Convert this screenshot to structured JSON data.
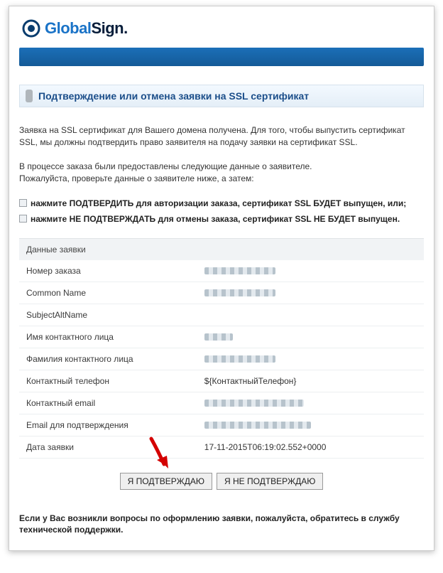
{
  "brand": {
    "global": "Global",
    "sign": "Sign",
    "dot": "."
  },
  "title": "Подтверждение или отмена заявки на SSL сертификат",
  "intro": "Заявка на SSL сертификат для Вашего домена получена. Для того, чтобы выпустить сертификат SSL, мы должны подтвердить право заявителя на подачу заявки на сертификат SSL.",
  "process1": "В процессе заказа были предоставлены следующие данные о заявителе.",
  "process2": "Пожалуйста, проверьте данные о заявителе ниже, а затем:",
  "bullets": [
    "нажмите ПОДТВЕРДИТЬ для авторизации заказа, сертификат SSL БУДЕТ выпущен, или;",
    "нажмите НЕ ПОДТВЕРЖДАТЬ для отмены заказа, сертификат SSL НЕ БУДЕТ выпущен."
  ],
  "section_header": "Данные заявки",
  "rows": {
    "order_no": {
      "label": "Номер заказа",
      "value": ""
    },
    "common_name": {
      "label": "Common Name",
      "value": ""
    },
    "san": {
      "label": "SubjectAltName",
      "value": ""
    },
    "first_name": {
      "label": "Имя контактного лица",
      "value": ""
    },
    "last_name": {
      "label": "Фамилия контактного лица",
      "value": ""
    },
    "phone": {
      "label": "Контактный телефон",
      "value": "${КонтактныйТелефон}"
    },
    "email": {
      "label": "Контактный email",
      "value": ""
    },
    "approve_email": {
      "label": "Email для подтверждения",
      "value": ""
    },
    "date": {
      "label": "Дата заявки",
      "value": "17-11-2015T06:19:02.552+0000"
    }
  },
  "buttons": {
    "approve": "Я ПОДТВЕРЖДАЮ",
    "decline": "Я НЕ ПОДТВЕРЖДАЮ"
  },
  "footer": "Если у Вас возникли вопросы по оформлению заявки, пожалуйста, обратитесь в службу технической поддержки."
}
